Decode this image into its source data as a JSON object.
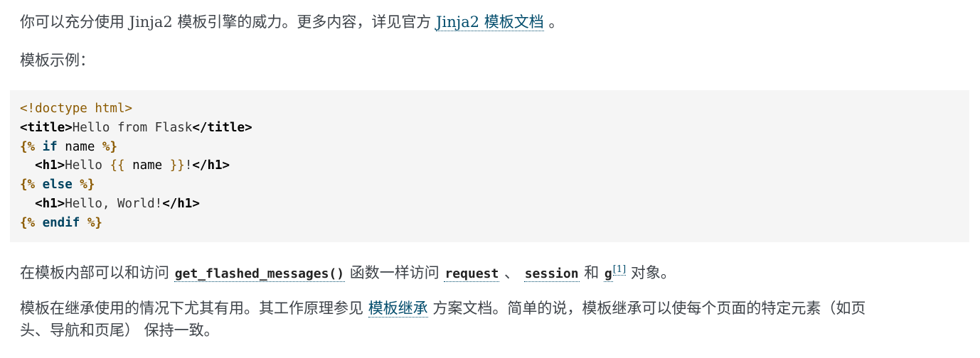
{
  "para1": {
    "text": "你可以充分使用 Jinja2 模板引擎的威力。更多内容，详见官方 ",
    "link": "Jinja2 模板文档",
    "end": " 。"
  },
  "para2": {
    "text": "模板示例："
  },
  "code": {
    "l1": "<!doctype html>",
    "l2_open": "<title>",
    "l2_text": "Hello from Flask",
    "l2_close": "</title>",
    "l3_open": "{%",
    "l3_kw": " if ",
    "l3_name": "name",
    "l3_close": " %}",
    "l4_indent": "  ",
    "l4_open": "<h1>",
    "l4_text": "Hello ",
    "l4_var_open": "{{",
    "l4_name": " name ",
    "l4_var_close": "}}",
    "l4_bang": "!",
    "l4_close": "</h1>",
    "l5_open": "{%",
    "l5_kw": " else ",
    "l5_close": "%}",
    "l6_indent": "  ",
    "l6_open": "<h1>",
    "l6_text": "Hello, World!",
    "l6_close": "</h1>",
    "l7_open": "{%",
    "l7_kw": " endif ",
    "l7_close": "%}"
  },
  "para3": {
    "t1": "在模板内部可以和访问 ",
    "c1": "get_flashed_messages()",
    "t2": " 函数一样访问 ",
    "c2": "request",
    "t3": " 、 ",
    "c3": "session",
    "t4": " 和 ",
    "c4": "g",
    "fn": "[1]",
    "t5": " 对象。"
  },
  "para4": {
    "t1": "模板在继承使用的情况下尤其有用。其工作原理参见 ",
    "link": "模板继承",
    "t2": " 方案文档。简单的说，模板继承可以使每个页面的特定元素（如页",
    "line2": "头、导航和页尾） 保持一致。"
  }
}
